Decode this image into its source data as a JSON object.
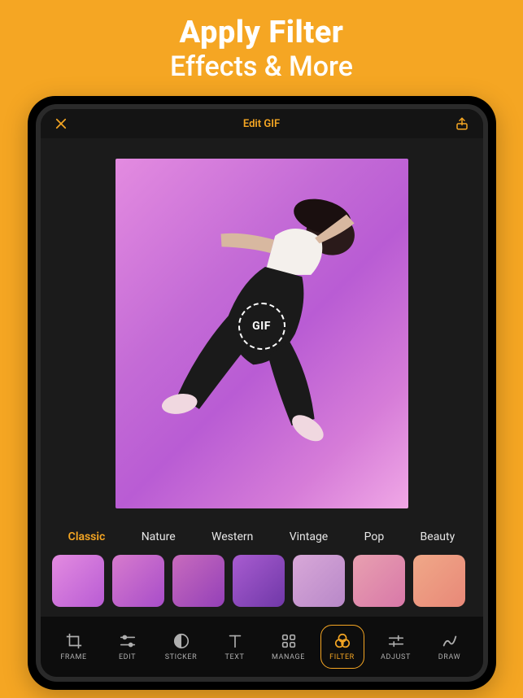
{
  "promo": {
    "line1": "Apply Filter",
    "line2": "Effects & More"
  },
  "colors": {
    "accent": "#f5a623",
    "background": "#f5a623"
  },
  "appBar": {
    "title": "Edit GIF"
  },
  "canvas": {
    "badge": "GIF"
  },
  "filterTabs": [
    {
      "label": "Classic",
      "active": true
    },
    {
      "label": "Nature",
      "active": false
    },
    {
      "label": "Western",
      "active": false
    },
    {
      "label": "Vintage",
      "active": false
    },
    {
      "label": "Pop",
      "active": false
    },
    {
      "label": "Beauty",
      "active": false
    }
  ],
  "thumbnails": [
    {
      "id": "thumb1"
    },
    {
      "id": "thumb2"
    },
    {
      "id": "thumb3"
    },
    {
      "id": "thumb4"
    },
    {
      "id": "thumb5"
    },
    {
      "id": "thumb6"
    },
    {
      "id": "thumb7"
    }
  ],
  "toolbar": [
    {
      "label": "FRAME",
      "icon": "crop-icon",
      "active": false
    },
    {
      "label": "EDIT",
      "icon": "sliders-icon",
      "active": false
    },
    {
      "label": "STICKER",
      "icon": "sticker-icon",
      "active": false
    },
    {
      "label": "TEXT",
      "icon": "text-icon",
      "active": false
    },
    {
      "label": "MANAGE",
      "icon": "grid-icon",
      "active": false
    },
    {
      "label": "FILTER",
      "icon": "filter-icon",
      "active": true
    },
    {
      "label": "ADJUST",
      "icon": "adjust-icon",
      "active": false
    },
    {
      "label": "DRAW",
      "icon": "draw-icon",
      "active": false
    }
  ]
}
